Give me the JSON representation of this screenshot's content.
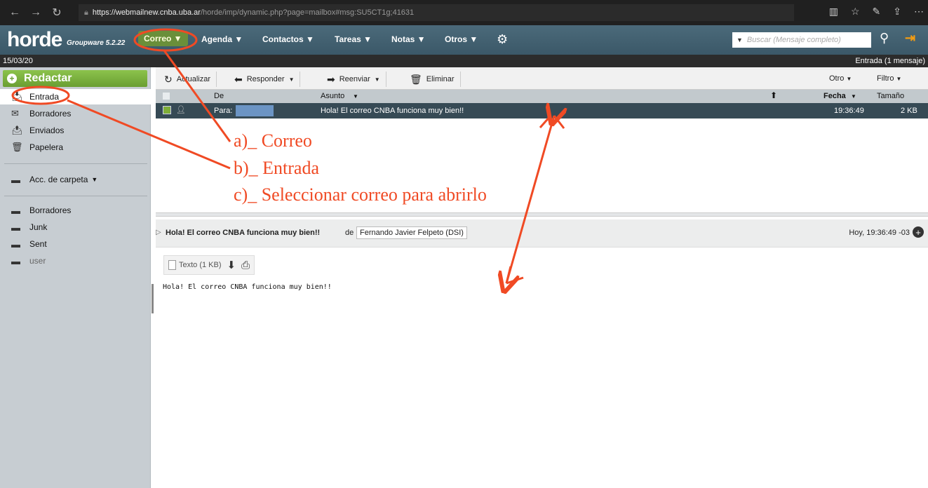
{
  "browser": {
    "url_host": "https://webmailnew.cnba.uba.ar",
    "url_path": "/horde/imp/dynamic.php?page=mailbox#msg:SU5CT1g;41631"
  },
  "app": {
    "logo": "horde",
    "logo_sub": "Groupware 5.2.22",
    "menu": [
      "Correo ▼",
      "Agenda ▼",
      "Contactos ▼",
      "Tareas ▼",
      "Notas ▼",
      "Otros ▼"
    ],
    "search_placeholder": "Buscar (Mensaje completo)"
  },
  "status": {
    "date": "15/03/20",
    "folder_info": "Entrada (1 mensaje)"
  },
  "sidebar": {
    "compose": "Redactar",
    "folders": [
      "Entrada",
      "Borradores",
      "Enviados",
      "Papelera"
    ],
    "folder_actions": "Acc. de carpeta",
    "other_folders": [
      "Borradores",
      "Junk",
      "Sent",
      "user"
    ]
  },
  "toolbar": {
    "refresh": "Actualizar",
    "reply": "Responder",
    "forward": "Reenviar",
    "delete": "Eliminar",
    "other": "Otro",
    "filter": "Filtro"
  },
  "list": {
    "headers": {
      "from": "De",
      "subject": "Asunto",
      "date": "Fecha",
      "size": "Tamaño"
    },
    "rows": [
      {
        "to": "Para:",
        "subject": "Hola! El correo CNBA funciona muy bien!!",
        "time": "19:36:49",
        "size": "2 KB"
      }
    ]
  },
  "preview": {
    "subject": "Hola! El correo CNBA funciona muy bien!!",
    "from_label": "de",
    "from": "Fernando Javier Felpeto (DSI)",
    "date": "Hoy, 19:36:49 -03",
    "attachment": "Texto (1 KB)",
    "body": "Hola! El correo CNBA funciona muy bien!!"
  },
  "annotations": {
    "a": "a)_ Correo",
    "b": "b)_ Entrada",
    "c": "c)_ Seleccionar correo para abrirlo"
  },
  "colors": {
    "annotation": "#f04a24",
    "nav_bg": "#3b5868",
    "compose_green": "#6a9e32",
    "selected_row": "#364a55"
  }
}
